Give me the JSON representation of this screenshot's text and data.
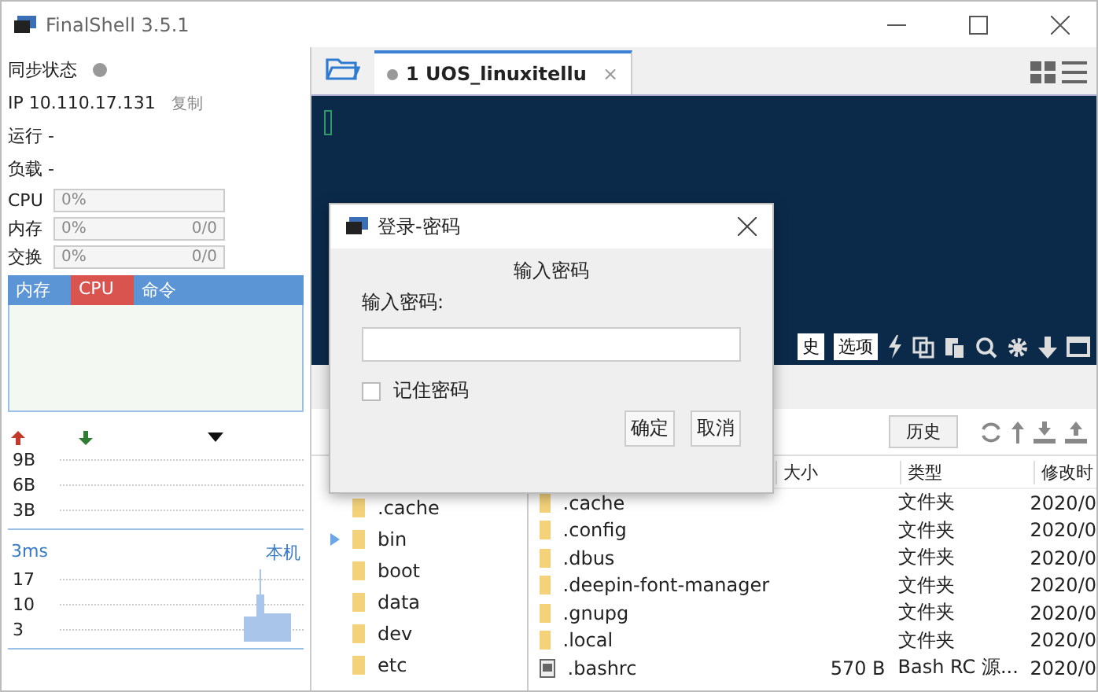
{
  "window": {
    "title": "FinalShell 3.5.1"
  },
  "sidebar": {
    "sync": {
      "label": "同步状态",
      "online": false
    },
    "ip": {
      "text": "IP 10.110.17.131",
      "copy": "复制"
    },
    "stats": [
      "运行 -",
      "负载 -"
    ],
    "meters": [
      {
        "label": "CPU",
        "reading": "0%",
        "level": 0
      },
      {
        "label": "内存",
        "reading": "0%",
        "extra": "0/0",
        "level": 0
      },
      {
        "label": "交换",
        "reading": "0%",
        "extra": "0/0",
        "level": 0
      }
    ],
    "tabs": [
      {
        "label": "内存",
        "selected": false
      },
      {
        "label": "CPU",
        "selected": true
      },
      {
        "label": "命令",
        "selected": false
      }
    ],
    "network": {
      "yticks": [
        "9B",
        "6B",
        "3B"
      ]
    },
    "latency": {
      "label": "3ms",
      "host": "本机",
      "yticks": [
        "17",
        "10",
        "3"
      ]
    }
  },
  "session_tabs": [
    {
      "label": "1 UOS_linuxitellu",
      "selected": true,
      "connected": false,
      "close": "×"
    }
  ],
  "terminal": {
    "buttons": [
      "史",
      "选项"
    ]
  },
  "files": {
    "history": "历史",
    "tree": [
      {
        "name": ".cache",
        "expandable": false
      },
      {
        "name": "bin",
        "expandable": true
      },
      {
        "name": "boot",
        "expandable": false
      },
      {
        "name": "data",
        "expandable": false
      },
      {
        "name": "dev",
        "expandable": false
      },
      {
        "name": "etc",
        "expandable": false
      }
    ],
    "columns": [
      "大小",
      "类型",
      "修改时"
    ],
    "rows": [
      {
        "kind": "folder",
        "name": ".cache",
        "type": "文件夹",
        "modified": "2020/0"
      },
      {
        "kind": "folder",
        "name": ".config",
        "type": "文件夹",
        "modified": "2020/0"
      },
      {
        "kind": "folder",
        "name": ".dbus",
        "type": "文件夹",
        "modified": "2020/0"
      },
      {
        "kind": "folder",
        "name": ".deepin-font-manager",
        "type": "文件夹",
        "modified": "2020/0"
      },
      {
        "kind": "folder",
        "name": ".gnupg",
        "type": "文件夹",
        "modified": "2020/0"
      },
      {
        "kind": "folder",
        "name": ".local",
        "type": "文件夹",
        "modified": "2020/0"
      },
      {
        "kind": "file",
        "name": ".bashrc",
        "size": "570 B",
        "type": "Bash RC 源...",
        "modified": "2020/0"
      }
    ]
  },
  "dialog": {
    "title": "登录-密码",
    "heading": "输入密码",
    "label": "输入密码:",
    "remember": {
      "label": "记住密码",
      "checked": false
    },
    "buttons": [
      "确定",
      "取消"
    ]
  }
}
